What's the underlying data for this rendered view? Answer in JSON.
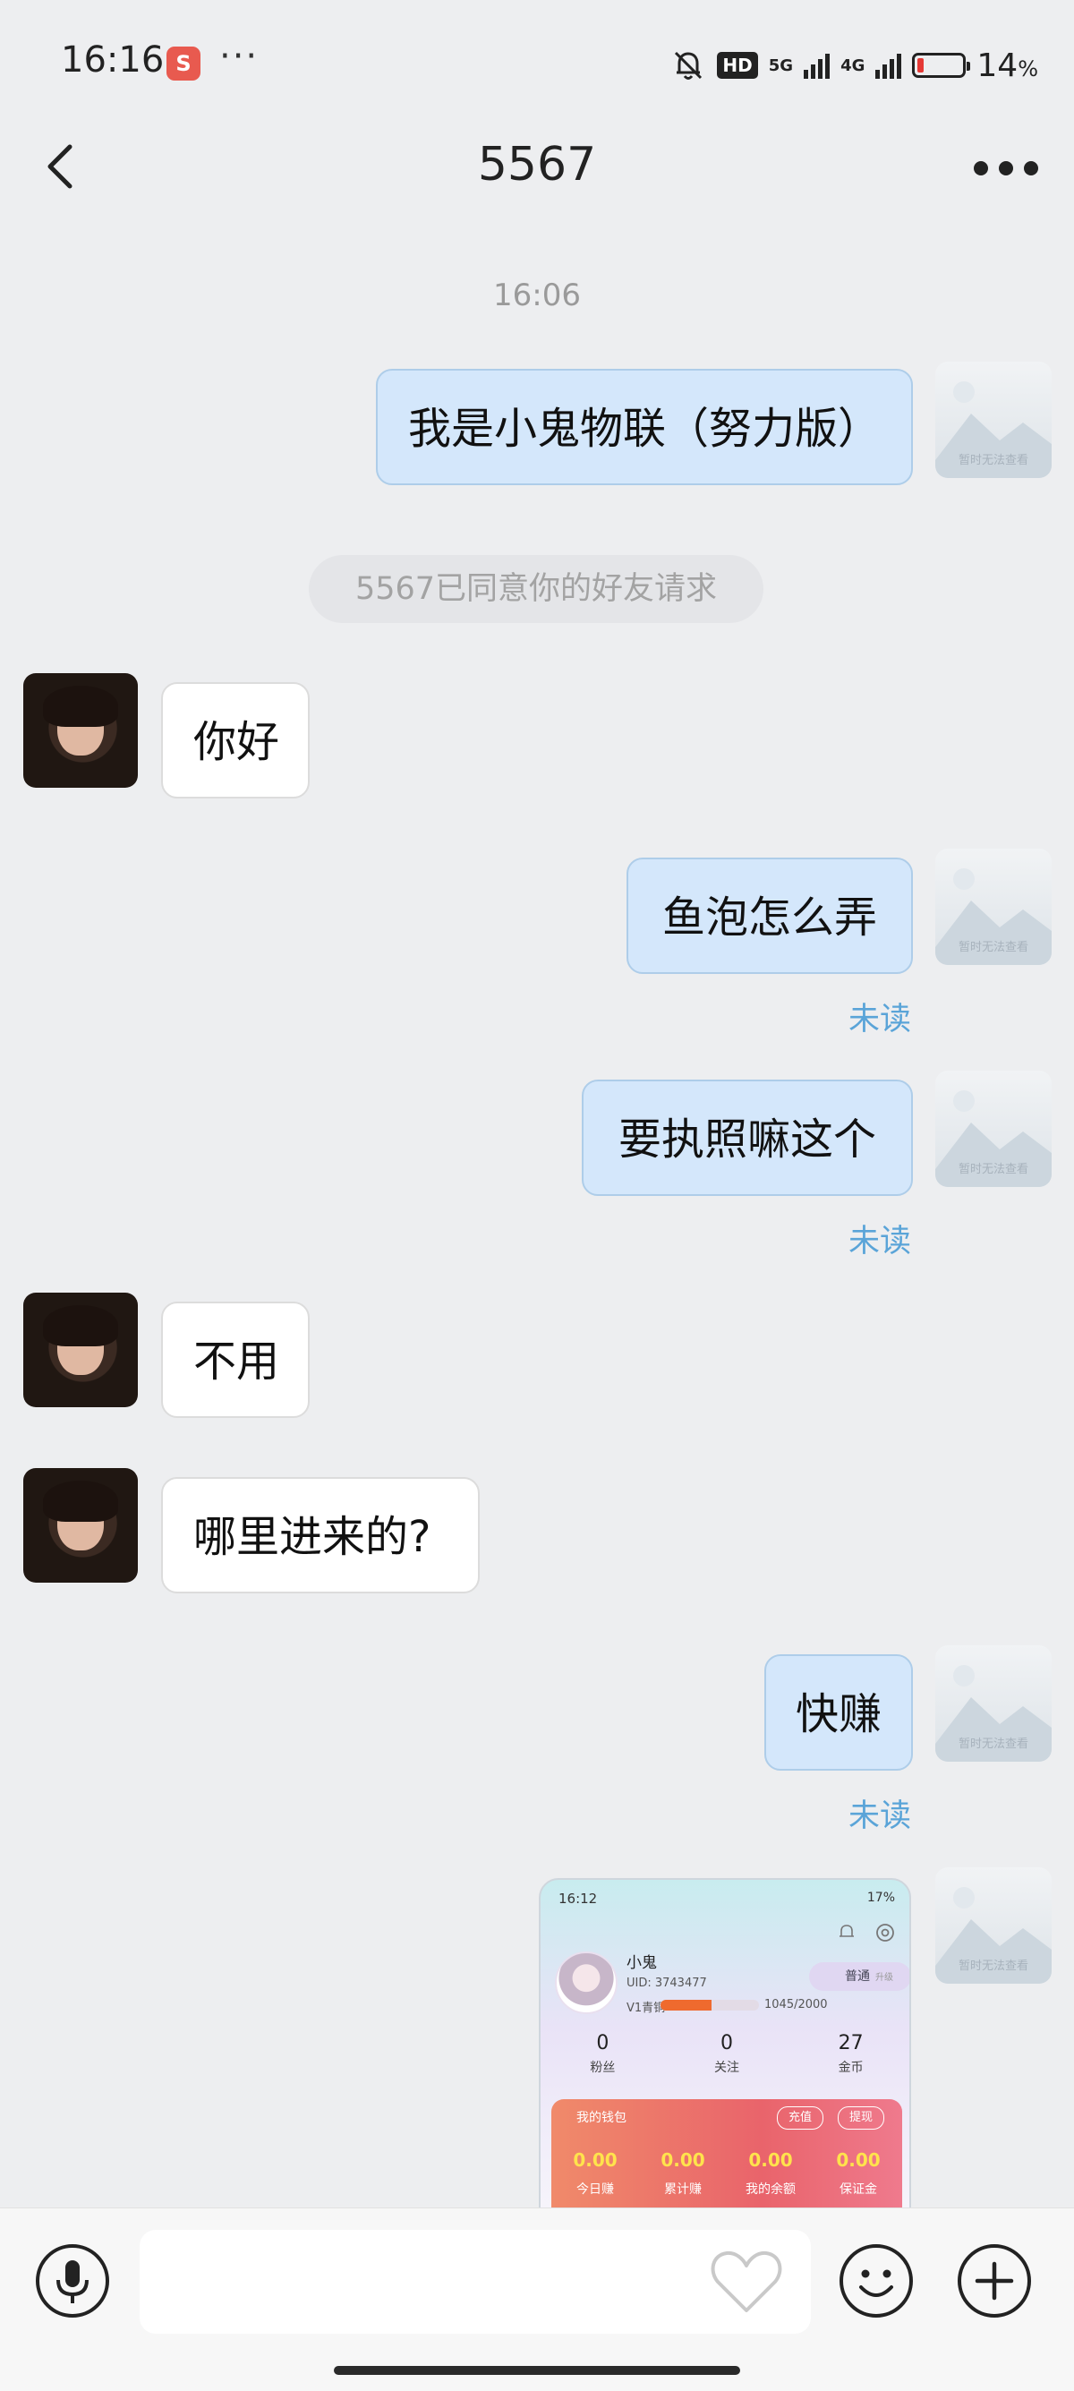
{
  "status_bar": {
    "time": "16:16",
    "app_icon_label": "S",
    "dots": "···",
    "hd": "HD",
    "net1": "5G",
    "net2": "4G",
    "battery": "14",
    "battery_unit": "%",
    "battery_level_percent": 14
  },
  "header": {
    "title": "5567",
    "back_icon": "chevron-left-icon",
    "more_icon": "more-horizontal-icon"
  },
  "chat": {
    "time_separator": "16:06",
    "system_notice": "5567已同意你的好友请求",
    "self_avatar_caption": "暂时无法查看",
    "messages": [
      {
        "side": "out",
        "text": "我是小鬼物联（努力版）"
      },
      {
        "side": "in",
        "text": "你好"
      },
      {
        "side": "out",
        "text": "鱼泡怎么弄",
        "status": "未读"
      },
      {
        "side": "out",
        "text": "要执照嘛这个",
        "status": "未读"
      },
      {
        "side": "in",
        "text": "不用"
      },
      {
        "side": "in",
        "text": "哪里进来的?"
      },
      {
        "side": "out",
        "text": "快赚",
        "status": "未读"
      }
    ],
    "image_message": {
      "status_time": "16:12",
      "status_right": "17%",
      "name": "小鬼",
      "uid": "UID: 3743477",
      "level": "V1青铜",
      "progress": "1045/2000",
      "progress_fraction": 0.5225,
      "badge": "普通",
      "badge_small": "升级",
      "stats": [
        {
          "value": "0",
          "label": "粉丝"
        },
        {
          "value": "0",
          "label": "关注"
        },
        {
          "value": "27",
          "label": "金币"
        }
      ],
      "wallet_title": "我的钱包",
      "recharge": "充值",
      "withdraw": "提现",
      "wallet_stats": [
        {
          "value": "0.00",
          "label": "今日赚"
        },
        {
          "value": "0.00",
          "label": "累计赚"
        },
        {
          "value": "0.00",
          "label": "我的余额"
        },
        {
          "value": "0.00",
          "label": "保证金"
        }
      ]
    }
  },
  "input_bar": {
    "voice_icon": "microphone-icon",
    "like_icon": "heart-icon",
    "emoji_icon": "smiley-icon",
    "plus_icon": "plus-circle-icon",
    "input_value": ""
  },
  "colors": {
    "background": "#edeef0",
    "out_bubble": "#d4e7fb",
    "in_bubble": "#ffffff",
    "unread": "#5aa4d8"
  }
}
